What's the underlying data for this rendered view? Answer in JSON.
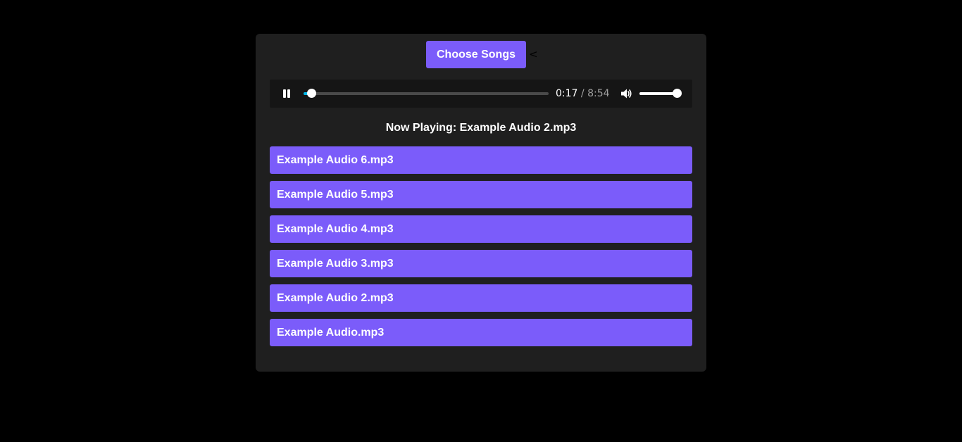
{
  "header": {
    "choose_button_label": "Choose Songs",
    "caret": "<"
  },
  "player": {
    "state": "playing",
    "current_time": "0:17",
    "separator": "/",
    "duration": "8:54",
    "progress_fraction": 0.032,
    "volume_fraction": 0.9,
    "pause_icon": "pause-icon",
    "volume_icon": "volume-icon",
    "accent_color": "#00b7e8"
  },
  "now_playing": {
    "text": "Now Playing: Example Audio 2.mp3"
  },
  "songs": [
    {
      "label": "Example Audio 6.mp3"
    },
    {
      "label": "Example Audio 5.mp3"
    },
    {
      "label": "Example Audio 4.mp3"
    },
    {
      "label": "Example Audio 3.mp3"
    },
    {
      "label": "Example Audio 2.mp3"
    },
    {
      "label": "Example Audio.mp3"
    }
  ],
  "colors": {
    "background": "#000000",
    "panel": "#1f1f1f",
    "button": "#7b5cfa",
    "player_bar": "#151515"
  }
}
